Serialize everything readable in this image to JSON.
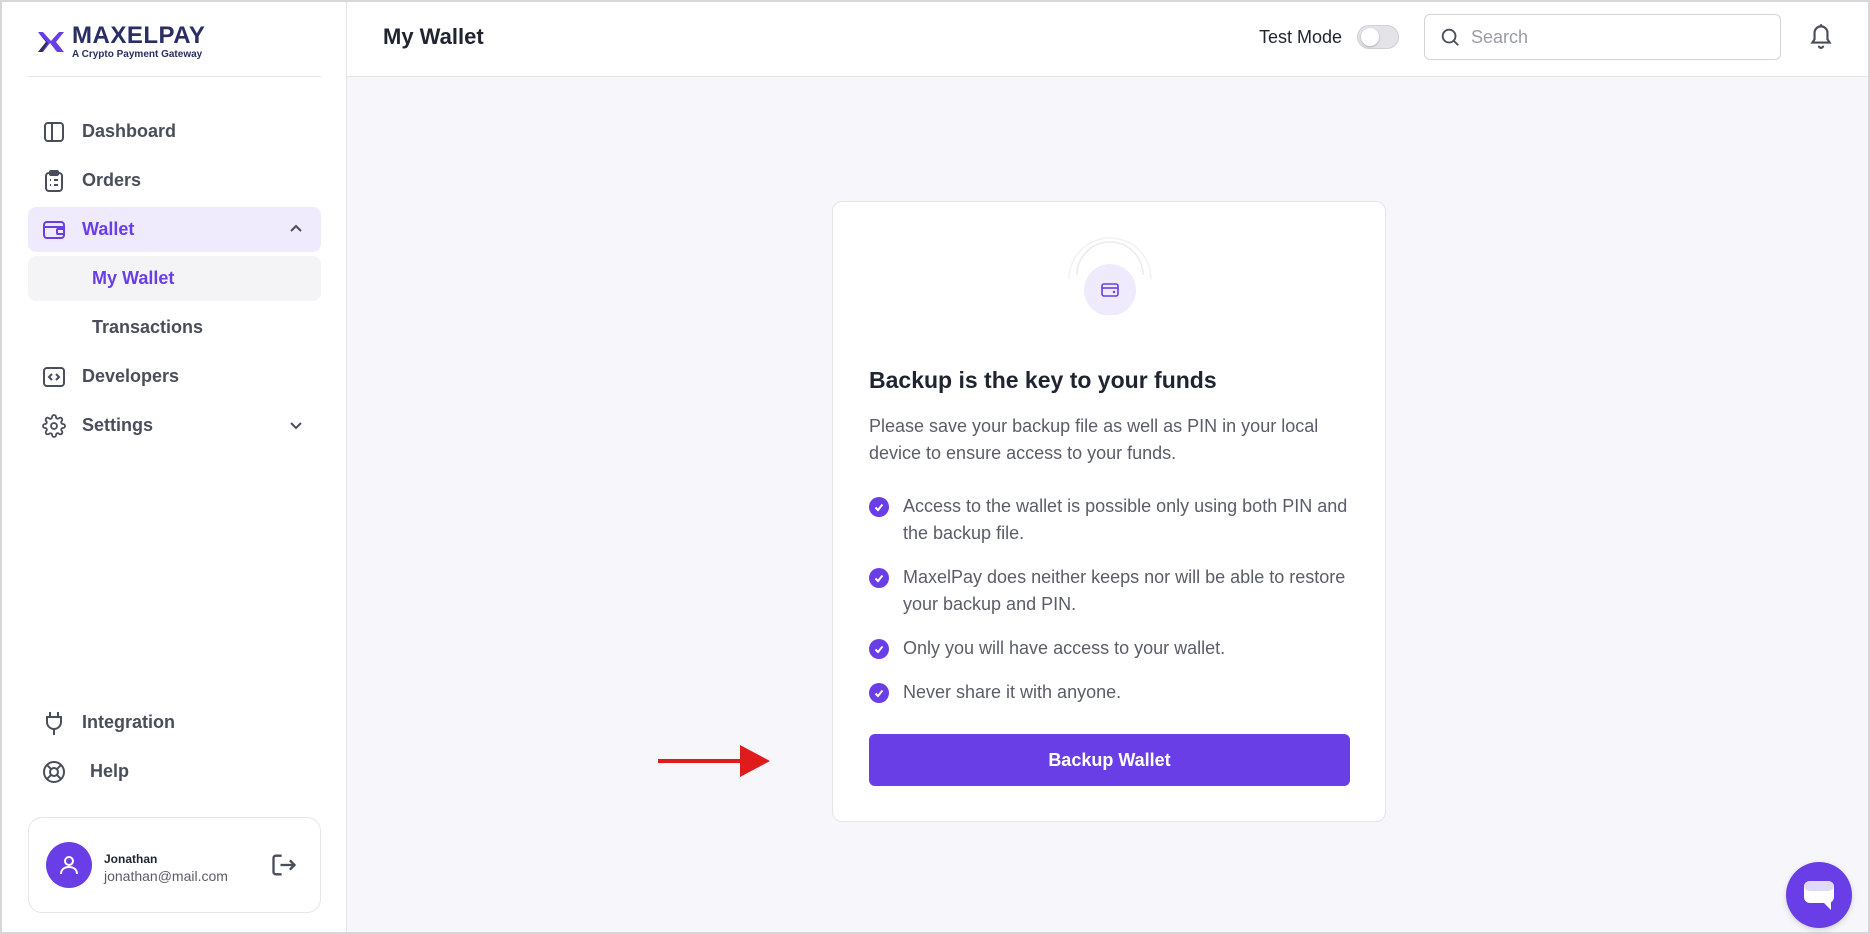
{
  "brand": {
    "name": "MAXELPAY",
    "tagline": "A Crypto Payment Gateway",
    "accent": "#6a3ee6"
  },
  "sidebar": {
    "items": [
      {
        "label": "Dashboard",
        "icon": "dashboard-icon"
      },
      {
        "label": "Orders",
        "icon": "orders-icon"
      },
      {
        "label": "Wallet",
        "icon": "wallet-icon",
        "expanded": true
      },
      {
        "label": "My Wallet",
        "selected": true
      },
      {
        "label": "Transactions"
      },
      {
        "label": "Developers",
        "icon": "code-icon"
      },
      {
        "label": "Settings",
        "icon": "gear-icon"
      }
    ],
    "bottom_items": [
      {
        "label": "Integration",
        "icon": "plug-icon"
      },
      {
        "label": "Help",
        "icon": "lifebuoy-icon"
      }
    ],
    "user": {
      "name": "Jonathan",
      "email": "jonathan@mail.com"
    }
  },
  "header": {
    "title": "My Wallet",
    "test_mode_label": "Test Mode",
    "test_mode_on": false,
    "search_placeholder": "Search"
  },
  "card": {
    "title": "Backup is the key to your funds",
    "description": "Please save your backup file as well as PIN in your local device to ensure access to your funds.",
    "checklist": [
      "Access to the wallet is possible only using both PIN and the backup file.",
      "MaxelPay does neither keeps nor will be able to restore your backup and PIN.",
      "Only you will have access to your wallet.",
      "Never share it with anyone."
    ],
    "button_label": "Backup Wallet"
  }
}
